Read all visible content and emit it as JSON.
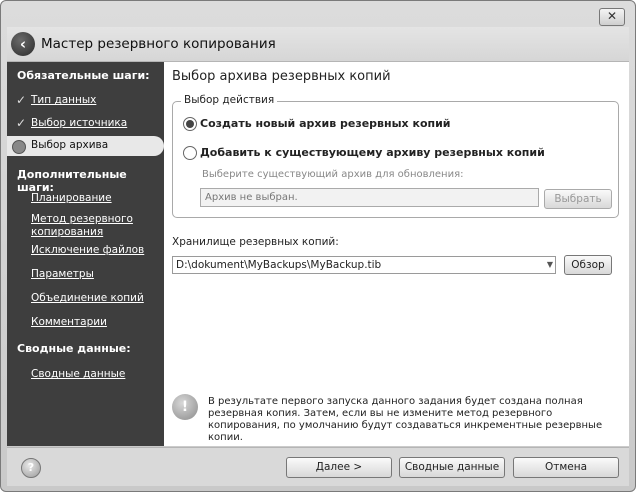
{
  "window": {
    "title": "Мастер резервного копирования",
    "close_glyph": "✕"
  },
  "sidebar": {
    "required_heading": "Обязательные шаги:",
    "required_steps": [
      {
        "label": "Тип данных",
        "done": true
      },
      {
        "label": "Выбор источника",
        "done": true
      },
      {
        "label": "Выбор архива",
        "active": true
      }
    ],
    "optional_heading": "Дополнительные шаги:",
    "optional_steps": [
      "Планирование",
      "Метод резервного копирования",
      "Исключение файлов",
      "Параметры",
      "Объединение копий",
      "Комментарии"
    ],
    "summary_heading": "Сводные данные:",
    "summary_steps": [
      "Сводные данные"
    ]
  },
  "content": {
    "title": "Выбор архива резервных копий",
    "action_group": {
      "legend": "Выбор действия",
      "option_new": "Создать новый архив резервных копий",
      "option_existing": "Добавить к существующему архиву резервных копий",
      "existing_hint": "Выберите существующий архив для обновления:",
      "existing_field_value": "Архив не выбран.",
      "select_button": "Выбрать"
    },
    "storage_label": "Хранилище резервных копий:",
    "storage_path": "D:\\dokument\\MyBackups\\MyBackup.tib",
    "browse_button": "Обзор",
    "info_text": "В результате первого запуска данного задания будет создана полная резервная копия. Затем, если вы не измените метод резервного копирования, по умолчанию будут создаваться инкрементные резервные копии."
  },
  "footer": {
    "next_button": "Далее >",
    "summary_button": "Сводные данные",
    "cancel_button": "Отмена"
  }
}
